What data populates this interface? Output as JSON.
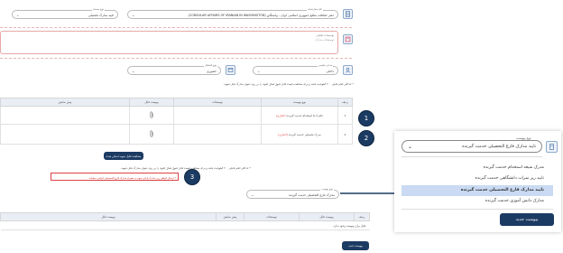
{
  "top": {
    "doc_type_label": "نوع مستند",
    "doc_type_value": "تایید مدارک تحصیلی",
    "agency_label": "نام سفارتخانه",
    "agency_value": "دفتر حفاظت منافع جمهوری اسلامی ایران - واشنگتن (CONSULAR AFFAIRS OF IRANIAN IN WASHINGTON)",
    "desc_label": "توضیحات تکمیلی",
    "desc_placeholder": "توضیحات مدارک"
  },
  "row2": {
    "applicant_label": "مدعی ملیحی",
    "applicant_value": "داخلی",
    "issuer_label": "نوع اشتغال",
    "issuer_value": "حضوری",
    "note": "* حداکثر حجم فایلی ۲۰۰ کیلوبایت باشد و برای مشاهده قیمت قابل قبول فعال جلوی را بر روی عنوان مدارک فایل شوید."
  },
  "table1": {
    "headers": [
      "ردیف",
      "نوع پیوست",
      "توضیحات",
      "پیوست فایل",
      "پیش نمایش"
    ],
    "rows": [
      {
        "num": "1",
        "type": "حکم ادعا استخدام خدمت گیرنده",
        "req": "(اجباری)"
      },
      {
        "num": "2",
        "type": "مدرک تحصیلی خدمت گیرنده",
        "req": "(اجباری)"
      }
    ]
  },
  "mid": {
    "button_label": "مشاهده فایل نمونه اسکن شده",
    "note": "* حداکثر حجم فایلی ۲۰۰ کیلوبایت باشد و برای مشاهده قیمت قابل قبول فعال جلوی را بر روی عنوان مدارک فایل شوید.",
    "warning": "* ارسال گواهی زیر مدارک پایانی نمونه به همراه مدارک فارغ التحصیلی الزامی میباشد.",
    "select_label": "نوع پیوست",
    "select_value": "مدارک فارغ التحصیلی خدمت گیرنده"
  },
  "table2": {
    "headers": [
      "ردیف",
      "پیوست فایل",
      "توضیحات",
      "پیش نمایش",
      "پیوست فایل"
    ],
    "empty_text": "فایل برای پیوست وجود ندارد."
  },
  "bottom_button": "پیوست جدید",
  "badges": [
    "1",
    "2",
    "3"
  ],
  "popup": {
    "select_label": "نوع پیوست",
    "select_value": "تایید مدارک فارغ التحصیلی خدمت گیرنده",
    "options": [
      "مدرک شیعه استخدام خدمت گیرنده",
      "تایید ریز نمرات دانشگاهی خدمت گیرنده",
      "تایید مدارک فارغ التحصیلی خدمت گیرنده",
      "مدارک دانش آموزی خدمت گیرنده"
    ],
    "selected_index": 2,
    "button_label": "پیوست جدید"
  },
  "colors": {
    "navy": "#1c3b63",
    "header_bg": "#e9eef5",
    "highlight": "#c9daf2",
    "required": "#d33"
  }
}
